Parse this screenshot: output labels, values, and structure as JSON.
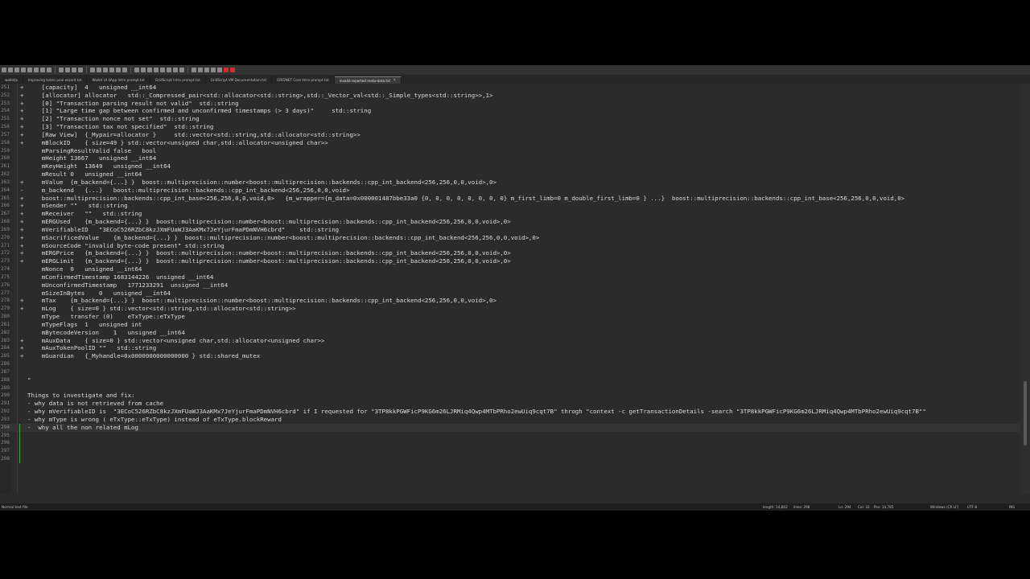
{
  "toolbar": {
    "icons": [
      "new-file-icon",
      "open-icon",
      "save-icon",
      "save-all-icon",
      "close-icon",
      "close-all-icon",
      "print-icon",
      "cut-icon",
      "copy-icon",
      "paste-icon",
      "undo-icon",
      "redo-icon",
      "find-icon",
      "replace-icon",
      "zoom-in-icon",
      "zoom-out-icon",
      "sync-v-icon",
      "sync-h-icon",
      "word-wrap-icon",
      "show-all-icon",
      "indent-guide-icon",
      "lang-icon",
      "doc-map-icon",
      "func-list-icon",
      "folder-icon",
      "monitor-icon",
      "record-icon",
      "stop-icon",
      "play-icon",
      "play-multi-icon",
      "save-macro-icon",
      "spell-icon",
      "spell-next-icon"
    ],
    "red_icons": [
      31,
      32
    ]
  },
  "tabs": [
    {
      "label": "walletjs",
      "active": false
    },
    {
      "label": "Improving token pool wizard.txt",
      "active": false
    },
    {
      "label": "Wallet UI dApp Intro prompt.txt",
      "active": false
    },
    {
      "label": "GridScript Intro prompt.txt",
      "active": false
    },
    {
      "label": "GridScript VM Documentation.txt",
      "active": false
    },
    {
      "label": "GRIDNET Core Intro prompt.txt",
      "active": false
    },
    {
      "label": "invalid reported meta-data.txt",
      "active": true
    }
  ],
  "lines": [
    {
      "n": "251",
      "m": "+",
      "t": "    [capacity]  4   unsigned __int64"
    },
    {
      "n": "252",
      "m": "+",
      "t": "    [allocator] allocator   std::_Compressed_pair<std::allocator<std::string>,std::_Vector_val<std::_Simple_types<std::string>>,1>"
    },
    {
      "n": "253",
      "m": "+",
      "t": "    [0] \"Transaction parsing result not valid\"  std::string"
    },
    {
      "n": "254",
      "m": "+",
      "t": "    [1] \"Large time gap between confirmed and unconfirmed timestamps (> 3 days)\"     std::string"
    },
    {
      "n": "255",
      "m": "+",
      "t": "    [2] \"Transaction nonce not set\"  std::string"
    },
    {
      "n": "256",
      "m": "+",
      "t": "    [3] \"Transaction tax not specified\"  std::string"
    },
    {
      "n": "257",
      "m": "+",
      "t": "    [Raw View]  {_Mypair=allocator }     std::vector<std::string,std::allocator<std::string>>"
    },
    {
      "n": "258",
      "m": "+",
      "t": "    mBlockID    { size=49 } std::vector<unsigned char,std::allocator<unsigned char>>"
    },
    {
      "n": "259",
      "m": "",
      "t": "    mParsingResultValid false   bool"
    },
    {
      "n": "260",
      "m": "",
      "t": "    mHeight 13667   unsigned __int64"
    },
    {
      "n": "261",
      "m": "",
      "t": "    mKeyHeight  13649   unsigned __int64"
    },
    {
      "n": "262",
      "m": "",
      "t": "    mResult 0   unsigned __int64"
    },
    {
      "n": "263",
      "m": "+",
      "t": "    mValue  {m_backend={...} }  boost::multiprecision::number<boost::multiprecision::backends::cpp_int_backend<256,256,0,0,void>,0>"
    },
    {
      "n": "264",
      "m": "-",
      "t": "    m_backend   {...}   boost::multiprecision::backends::cpp_int_backend<256,256,0,0,void>"
    },
    {
      "n": "265",
      "m": "+",
      "t": "    boost::multiprecision::backends::cpp_int_base<256,256,0,0,void,0>   {m_wrapper={m_data=0x000001487bbe33a0 {0, 0, 0, 0, 0, 0, 0, 0} m_first_limb=0 m_double_first_limb=0 } ...}  boost::multiprecision::backends::cpp_int_base<256,256,0,0,void,0>"
    },
    {
      "n": "266",
      "m": "+",
      "t": "    mSender \"\"   std::string"
    },
    {
      "n": "267",
      "m": "+",
      "t": "    mReceiver   \"\"   std::string"
    },
    {
      "n": "268",
      "m": "+",
      "t": "    mERGUsed    {m_backend={...} }  boost::multiprecision::number<boost::multiprecision::backends::cpp_int_backend<256,256,0,0,void>,0>"
    },
    {
      "n": "269",
      "m": "+",
      "t": "    mVerifiableID   \"3ECoC526RZbC8kzJXmFUaWJ3AaKMx7JeYjurFmaPDmNVH6cbrd\"    std::string"
    },
    {
      "n": "270",
      "m": "+",
      "t": "    mSacrificedValue    {m_backend={...} }  boost::multiprecision::number<boost::multiprecision::backends::cpp_int_backend<256,256,0,0,void>,0>"
    },
    {
      "n": "271",
      "m": "+",
      "t": "    mSourceCode \"invalid byte-code present\" std::string"
    },
    {
      "n": "272",
      "m": "+",
      "t": "    mERGPrice   {m_backend={...} }  boost::multiprecision::number<boost::multiprecision::backends::cpp_int_backend<256,256,0,0,void>,0>"
    },
    {
      "n": "273",
      "m": "+",
      "t": "    mERGLimit   {m_backend={...} }  boost::multiprecision::number<boost::multiprecision::backends::cpp_int_backend<256,256,0,0,void>,0>"
    },
    {
      "n": "274",
      "m": "",
      "t": "    mNonce  0   unsigned __int64"
    },
    {
      "n": "275",
      "m": "",
      "t": "    mConfirmedTimestamp 1683144226  unsigned __int64"
    },
    {
      "n": "276",
      "m": "",
      "t": "    mUnconfirmedTimestamp   1771233291  unsigned __int64"
    },
    {
      "n": "277",
      "m": "",
      "t": "    mSizeInBytes    0   unsigned __int64"
    },
    {
      "n": "278",
      "m": "+",
      "t": "    mTax    {m_backend={...} }  boost::multiprecision::number<boost::multiprecision::backends::cpp_int_backend<256,256,0,0,void>,0>"
    },
    {
      "n": "279",
      "m": "+",
      "t": "    mLog    { size=0 } std::vector<std::string,std::allocator<std::string>>"
    },
    {
      "n": "280",
      "m": "",
      "t": "    mType   transfer (0)    eTxType::eTxType"
    },
    {
      "n": "281",
      "m": "",
      "t": "    mTypeFlags  1   unsigned int"
    },
    {
      "n": "282",
      "m": "",
      "t": "    mBytecodeVersion    1   unsigned __int64"
    },
    {
      "n": "283",
      "m": "+",
      "t": "    mAuxData    { size=0 } std::vector<unsigned char,std::allocator<unsigned char>>"
    },
    {
      "n": "284",
      "m": "+",
      "t": "    mAuxTokenPoolID \"\"   std::string"
    },
    {
      "n": "285",
      "m": "+",
      "t": "    mGuardian   {_Myhandle=0x0000000000000000 } std::shared_mutex"
    },
    {
      "n": "286",
      "m": "",
      "t": ""
    },
    {
      "n": "287",
      "m": "",
      "t": ""
    },
    {
      "n": "288",
      "m": "",
      "t": "\""
    },
    {
      "n": "289",
      "m": "",
      "t": ""
    },
    {
      "n": "290",
      "m": "",
      "t": "Things to investigate and fix:"
    },
    {
      "n": "291",
      "m": "",
      "t": "- why data is not retrieved from cache"
    },
    {
      "n": "292",
      "m": "",
      "t": "- why mVerifiableID is  \"3ECoC526RZbC8kzJXmFUaWJ3AaKMx7JeYjurFmaPDmNVH6cbrd\" if I requested for \"3TP8kkPGWFicP9KG6m26LJRMiq4Qwp4MTbPRho2ewUiq9cqt7B\" throgh \"context -c getTransactionDetails -search \"3TP8kkPGWFicP9KG6m26LJRMiq4Qwp4MTbPRho2ewUiq9cqt7B\"\""
    },
    {
      "n": "293",
      "m": "",
      "t": "- why mType is wrong ( eTxType::eTxType) instead of eTxType.blockReward"
    },
    {
      "n": "294",
      "m": "",
      "t": "-  why all the non related mLog"
    },
    {
      "n": "295",
      "m": "",
      "t": ""
    },
    {
      "n": "296",
      "m": "",
      "t": ""
    },
    {
      "n": "297",
      "m": "",
      "t": ""
    },
    {
      "n": "298",
      "m": "",
      "t": ""
    }
  ],
  "current_line_index": 43,
  "status": {
    "left": "Normal text file",
    "length": "length: 14,802",
    "lines": "lines: 298",
    "ln": "Ln: 294",
    "col": "Col: 32",
    "pos": "Pos: 14,785",
    "eol": "Windows (CR LF)",
    "encoding": "UTF-8",
    "mode": "INS"
  }
}
